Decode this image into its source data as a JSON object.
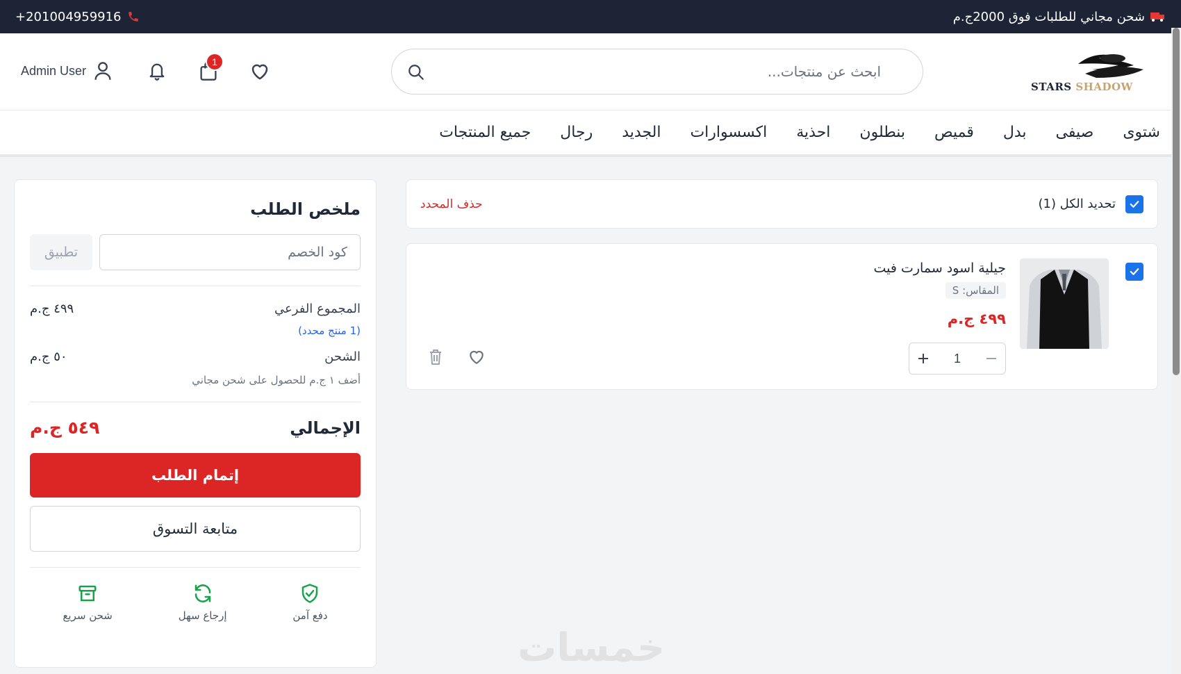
{
  "topbar": {
    "phone": "+201004959916",
    "promo": "شحن مجاني للطلبات فوق 2000ج.م"
  },
  "header": {
    "logo_text": "STARS SHADOW",
    "search_placeholder": "ابحث عن منتجات...",
    "user_name": "Admin User",
    "cart_count": "1"
  },
  "nav": {
    "items": [
      "شتوى",
      "صيفى",
      "بدل",
      "قميص",
      "بنطلون",
      "احذية",
      "اكسسوارات",
      "الجديد",
      "رجال",
      "جميع المنتجات"
    ]
  },
  "cart": {
    "select_all_label": "تحديد الكل (1)",
    "delete_selected_label": "حذف المحدد",
    "item": {
      "name": "جيلية اسود سمارت فيت",
      "size": "المقاس: S",
      "price": "٤٩٩ ج.م",
      "quantity": "1"
    }
  },
  "summary": {
    "title": "ملخص الطلب",
    "coupon_placeholder": "كود الخصم",
    "apply_label": "تطبيق",
    "subtotal_label": "المجموع الفرعي",
    "subtotal_value": "٤٩٩ ج.م",
    "selected_note": "(1 منتج محدد)",
    "shipping_label": "الشحن",
    "shipping_value": "٥٠ ج.م",
    "free_shipping_note": "أضف ١ ج.م للحصول على شحن مجاني",
    "total_label": "الإجمالي",
    "total_value": "٥٤٩ ج.م",
    "checkout_label": "إتمام الطلب",
    "continue_label": "متابعة التسوق",
    "features": [
      {
        "label": "دفع آمن",
        "icon": "shield-check-icon"
      },
      {
        "label": "إرجاع سهل",
        "icon": "refresh-icon"
      },
      {
        "label": "شحن سريع",
        "icon": "box-icon"
      }
    ]
  },
  "colors": {
    "accent_red": "#dc2626",
    "checkbox_blue": "#1a73e8",
    "topbar_bg": "#1c2436",
    "feature_green": "#16a34a"
  },
  "watermark": "خمسات"
}
